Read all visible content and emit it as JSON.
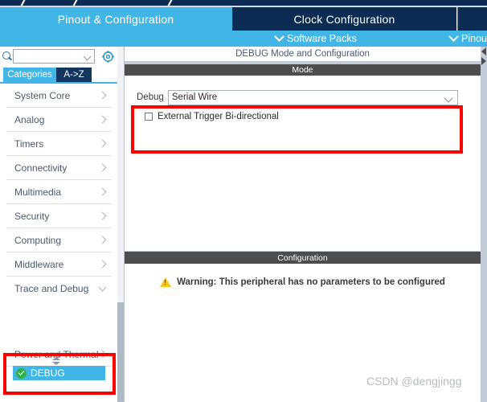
{
  "window": {
    "title_strip_color": "#0c2c54",
    "accent_color": "#41b6e6"
  },
  "tabs": [
    {
      "label": "Pinout & Configuration",
      "active": true
    },
    {
      "label": "Clock Configuration",
      "active": false
    },
    {
      "label": "",
      "active": false
    }
  ],
  "subbar": {
    "software_packs": "Software Packs",
    "pinout": "Pinou"
  },
  "sidebar": {
    "search": {
      "value": "",
      "placeholder": ""
    },
    "gear_icon": "gear-icon",
    "mode_tabs": [
      {
        "label": "Categories",
        "selected": true
      },
      {
        "label": "A->Z",
        "selected": false
      }
    ],
    "categories": [
      {
        "label": "System Core",
        "expanded": false
      },
      {
        "label": "Analog",
        "expanded": false
      },
      {
        "label": "Timers",
        "expanded": false
      },
      {
        "label": "Connectivity",
        "expanded": false
      },
      {
        "label": "Multimedia",
        "expanded": false
      },
      {
        "label": "Security",
        "expanded": false
      },
      {
        "label": "Computing",
        "expanded": false
      },
      {
        "label": "Middleware",
        "expanded": false
      },
      {
        "label": "Trace and Debug",
        "expanded": true
      }
    ],
    "selected_peripheral": {
      "label": "DEBUG",
      "status_icon": "check-circle-icon",
      "status_color": "#2fb14a",
      "highlight_color": "#41b6e6"
    },
    "after_group": [
      {
        "label": "Power and Thermal",
        "expanded": false
      }
    ]
  },
  "main": {
    "title": "DEBUG Mode and Configuration",
    "mode_section": {
      "header": "Mode",
      "debug_label": "Debug",
      "debug_value": "Serial Wire",
      "checkbox_label": "External Trigger Bi-directional",
      "checkbox_checked": false
    },
    "configuration_section": {
      "header": "Configuration",
      "warning_icon": "warning-triangle-icon",
      "warning_text": "Warning: This peripheral has no parameters to be configured"
    }
  },
  "annotations": {
    "highlight_color": "#fd0000",
    "boxes": [
      "sidebar-debug-item",
      "mode-section-fields"
    ]
  },
  "watermark": "CSDN @dengjingg"
}
